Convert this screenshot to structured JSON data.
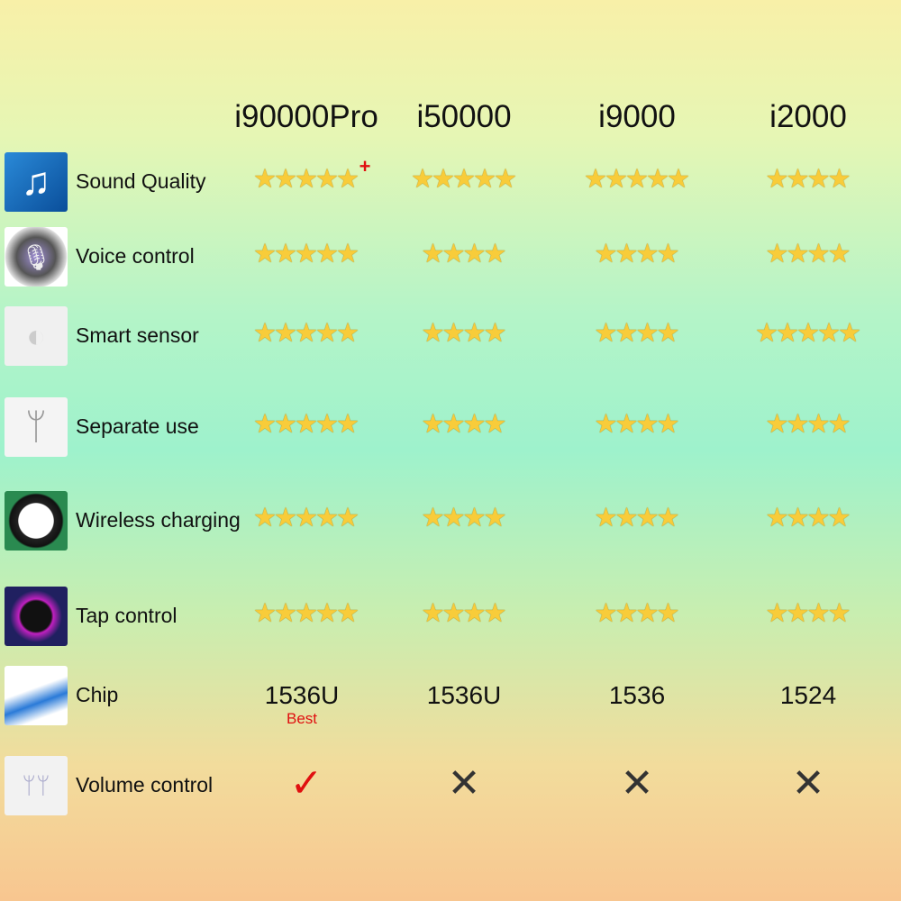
{
  "columns": [
    "i90000Pro",
    "i50000",
    "i9000",
    "i2000"
  ],
  "rows": [
    {
      "label": "Sound Quality",
      "icon": "music-note-icon",
      "stars": [
        5,
        5,
        5,
        4
      ],
      "plus": "+"
    },
    {
      "label": "Voice control",
      "icon": "microphone-icon",
      "stars": [
        5,
        4,
        4,
        4
      ]
    },
    {
      "label": "Smart sensor",
      "icon": "ear-sensor-icon",
      "stars": [
        5,
        4,
        4,
        5
      ]
    },
    {
      "label": "Separate use",
      "icon": "earbuds-icon",
      "stars": [
        5,
        4,
        4,
        4
      ]
    },
    {
      "label": "Wireless charging",
      "icon": "charging-case-icon",
      "stars": [
        5,
        4,
        4,
        4
      ]
    },
    {
      "label": "Tap control",
      "icon": "tap-icon",
      "stars": [
        5,
        4,
        4,
        4
      ]
    }
  ],
  "chip": {
    "label": "Chip",
    "icon": "chip-icon",
    "values": [
      "1536U",
      "1536U",
      "1536",
      "1524"
    ],
    "best": "Best"
  },
  "volume": {
    "label": "Volume control",
    "icon": "volume-earbuds-icon",
    "values": [
      "✓",
      "✕",
      "✕",
      "✕"
    ]
  },
  "colors": {
    "star": "#f8cc3a",
    "accent": "#e01010",
    "cross": "#333333"
  }
}
